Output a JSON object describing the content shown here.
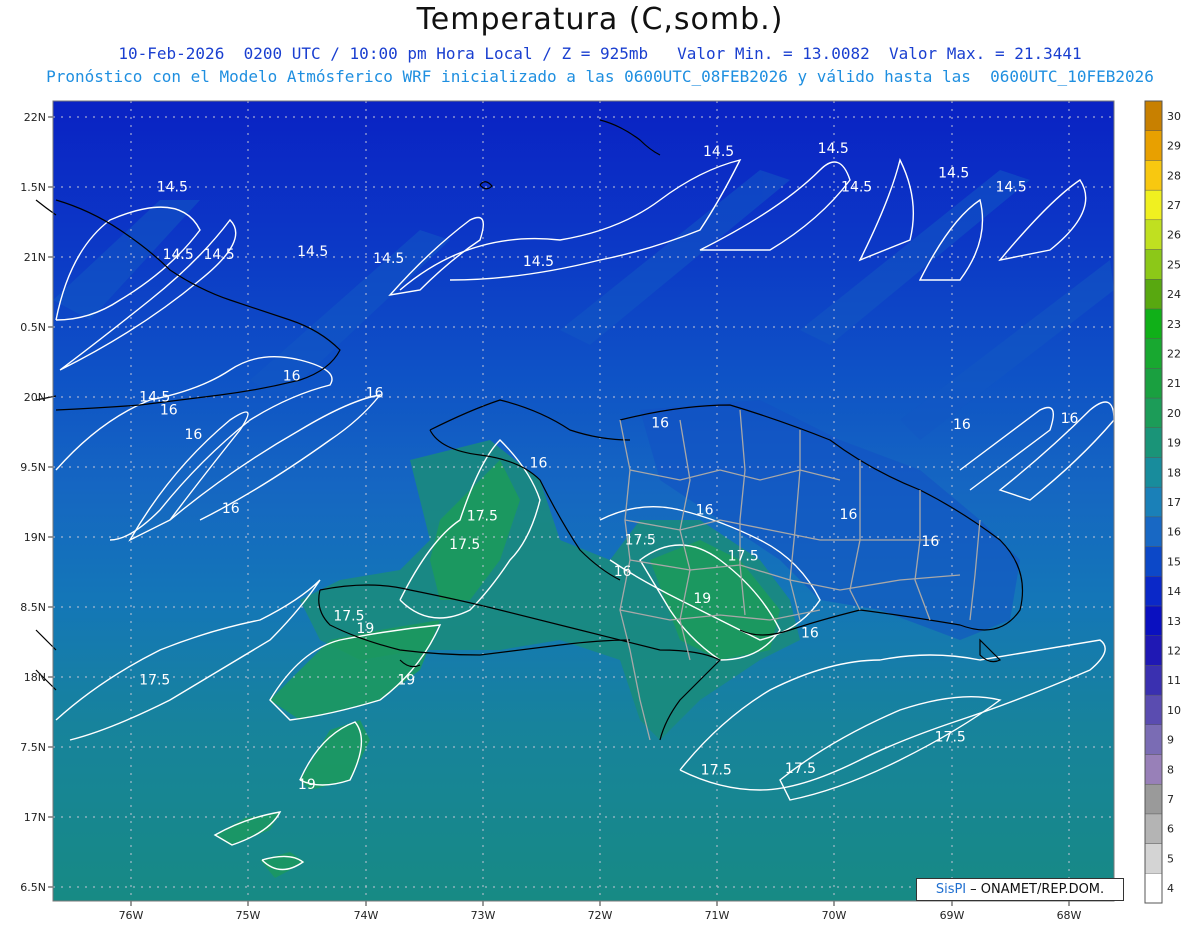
{
  "title": "Temperatura (C,somb.)",
  "subtitle_line1": "10-Feb-2026  0200 UTC / 10:00 pm Hora Local / Z = 925mb   Valor Min. = 13.0082  Valor Max. = 21.3441",
  "subtitle_line2": "Pronóstico con el Modelo Atmósferico WRF inicializado a las 0600UTC_08FEB2026 y válido hasta las  0600UTC_10FEB2026",
  "credit_logo": "SisPI",
  "credit_text": "– ONAMET/REP.DOM.",
  "colors": {
    "title": "#111111",
    "sub1": "#1a3fd0",
    "sub2": "#1f8fe0"
  },
  "chart_data": {
    "type": "heatmap",
    "variable": "Temperatura (C,somb.)",
    "level": "925mb",
    "valid": "10-Feb-2026 0200 UTC",
    "min_value": 13.0082,
    "max_value": 21.3441,
    "x_ticks": [
      "76W",
      "75W",
      "74W",
      "73W",
      "72W",
      "71W",
      "70W",
      "69W",
      "68W"
    ],
    "y_ticks": [
      "22N",
      "1.5N",
      "21N",
      "0.5N",
      "20N",
      "9.5N",
      "19N",
      "8.5N",
      "18N",
      "7.5N",
      "17N",
      "6.5N"
    ],
    "lon_range": [
      -76.67,
      -67.6
    ],
    "lat_range": [
      16.45,
      22.05
    ],
    "colorbar": [
      {
        "value": 4,
        "color": "#ffffff"
      },
      {
        "value": 5,
        "color": "#d4d4d4"
      },
      {
        "value": 6,
        "color": "#b4b4b4"
      },
      {
        "value": 7,
        "color": "#9a9a9a"
      },
      {
        "value": 8,
        "color": "#9880b8"
      },
      {
        "value": 9,
        "color": "#7a6cb4"
      },
      {
        "value": 10,
        "color": "#5a4cb0"
      },
      {
        "value": 11,
        "color": "#3a30b0"
      },
      {
        "value": 12,
        "color": "#1f18b4"
      },
      {
        "value": 13,
        "color": "#0a10c0"
      },
      {
        "value": 14,
        "color": "#0a28c8"
      },
      {
        "value": 15,
        "color": "#0c48c8"
      },
      {
        "value": 16,
        "color": "#1868c4"
      },
      {
        "value": 17,
        "color": "#1a80b8"
      },
      {
        "value": 18,
        "color": "#188c9c"
      },
      {
        "value": 19,
        "color": "#1a9478"
      },
      {
        "value": 20,
        "color": "#1c9c58"
      },
      {
        "value": 21,
        "color": "#1aa040"
      },
      {
        "value": 22,
        "color": "#18a830"
      },
      {
        "value": 23,
        "color": "#10b018"
      },
      {
        "value": 24,
        "color": "#58a810"
      },
      {
        "value": 25,
        "color": "#8cc818"
      },
      {
        "value": 26,
        "color": "#c0e020"
      },
      {
        "value": 27,
        "color": "#f0f020"
      },
      {
        "value": 28,
        "color": "#f8c810"
      },
      {
        "value": 29,
        "color": "#e8a000"
      },
      {
        "value": 30,
        "color": "#c88000"
      }
    ],
    "contour_labels": [
      {
        "value": "14.5",
        "lon": -75.65,
        "lat": 21.45
      },
      {
        "value": "14.5",
        "lon": -75.6,
        "lat": 20.98
      },
      {
        "value": "14.5",
        "lon": -75.25,
        "lat": 20.98
      },
      {
        "value": "14.5",
        "lon": -74.45,
        "lat": 21.0
      },
      {
        "value": "14.5",
        "lon": -73.8,
        "lat": 20.95
      },
      {
        "value": "14.5",
        "lon": -72.52,
        "lat": 20.93
      },
      {
        "value": "14.5",
        "lon": -70.98,
        "lat": 21.7
      },
      {
        "value": "14.5",
        "lon": -70.0,
        "lat": 21.72
      },
      {
        "value": "14.5",
        "lon": -69.8,
        "lat": 21.45
      },
      {
        "value": "14.5",
        "lon": -68.97,
        "lat": 21.55
      },
      {
        "value": "14.5",
        "lon": -68.48,
        "lat": 21.45
      },
      {
        "value": "14.5",
        "lon": -75.8,
        "lat": 19.98
      },
      {
        "value": "16",
        "lon": -74.63,
        "lat": 20.13
      },
      {
        "value": "16",
        "lon": -75.68,
        "lat": 19.89
      },
      {
        "value": "16",
        "lon": -75.47,
        "lat": 19.72
      },
      {
        "value": "16",
        "lon": -73.92,
        "lat": 20.01
      },
      {
        "value": "16",
        "lon": -75.15,
        "lat": 19.2
      },
      {
        "value": "16",
        "lon": -72.52,
        "lat": 19.52
      },
      {
        "value": "16",
        "lon": -71.48,
        "lat": 19.8
      },
      {
        "value": "16",
        "lon": -68.9,
        "lat": 19.79
      },
      {
        "value": "16",
        "lon": -67.98,
        "lat": 19.83
      },
      {
        "value": "16",
        "lon": -71.1,
        "lat": 19.19
      },
      {
        "value": "16",
        "lon": -69.87,
        "lat": 19.16
      },
      {
        "value": "16",
        "lon": -69.17,
        "lat": 18.97
      },
      {
        "value": "16",
        "lon": -71.8,
        "lat": 18.76
      },
      {
        "value": "16",
        "lon": -70.2,
        "lat": 18.33
      },
      {
        "value": "17.5",
        "lon": -73.0,
        "lat": 19.15
      },
      {
        "value": "17.5",
        "lon": -73.15,
        "lat": 18.95
      },
      {
        "value": "17.5",
        "lon": -71.65,
        "lat": 18.98
      },
      {
        "value": "17.5",
        "lon": -70.77,
        "lat": 18.87
      },
      {
        "value": "17.5",
        "lon": -74.14,
        "lat": 18.45
      },
      {
        "value": "17.5",
        "lon": -75.8,
        "lat": 18.0
      },
      {
        "value": "17.5",
        "lon": -69.0,
        "lat": 17.6
      },
      {
        "value": "17.5",
        "lon": -71.0,
        "lat": 17.37
      },
      {
        "value": "17.5",
        "lon": -70.28,
        "lat": 17.38
      },
      {
        "value": "19",
        "lon": -74.0,
        "lat": 18.36
      },
      {
        "value": "19",
        "lon": -71.12,
        "lat": 18.57
      },
      {
        "value": "19",
        "lon": -73.65,
        "lat": 18.0
      },
      {
        "value": "19",
        "lon": -74.5,
        "lat": 17.27
      }
    ]
  }
}
